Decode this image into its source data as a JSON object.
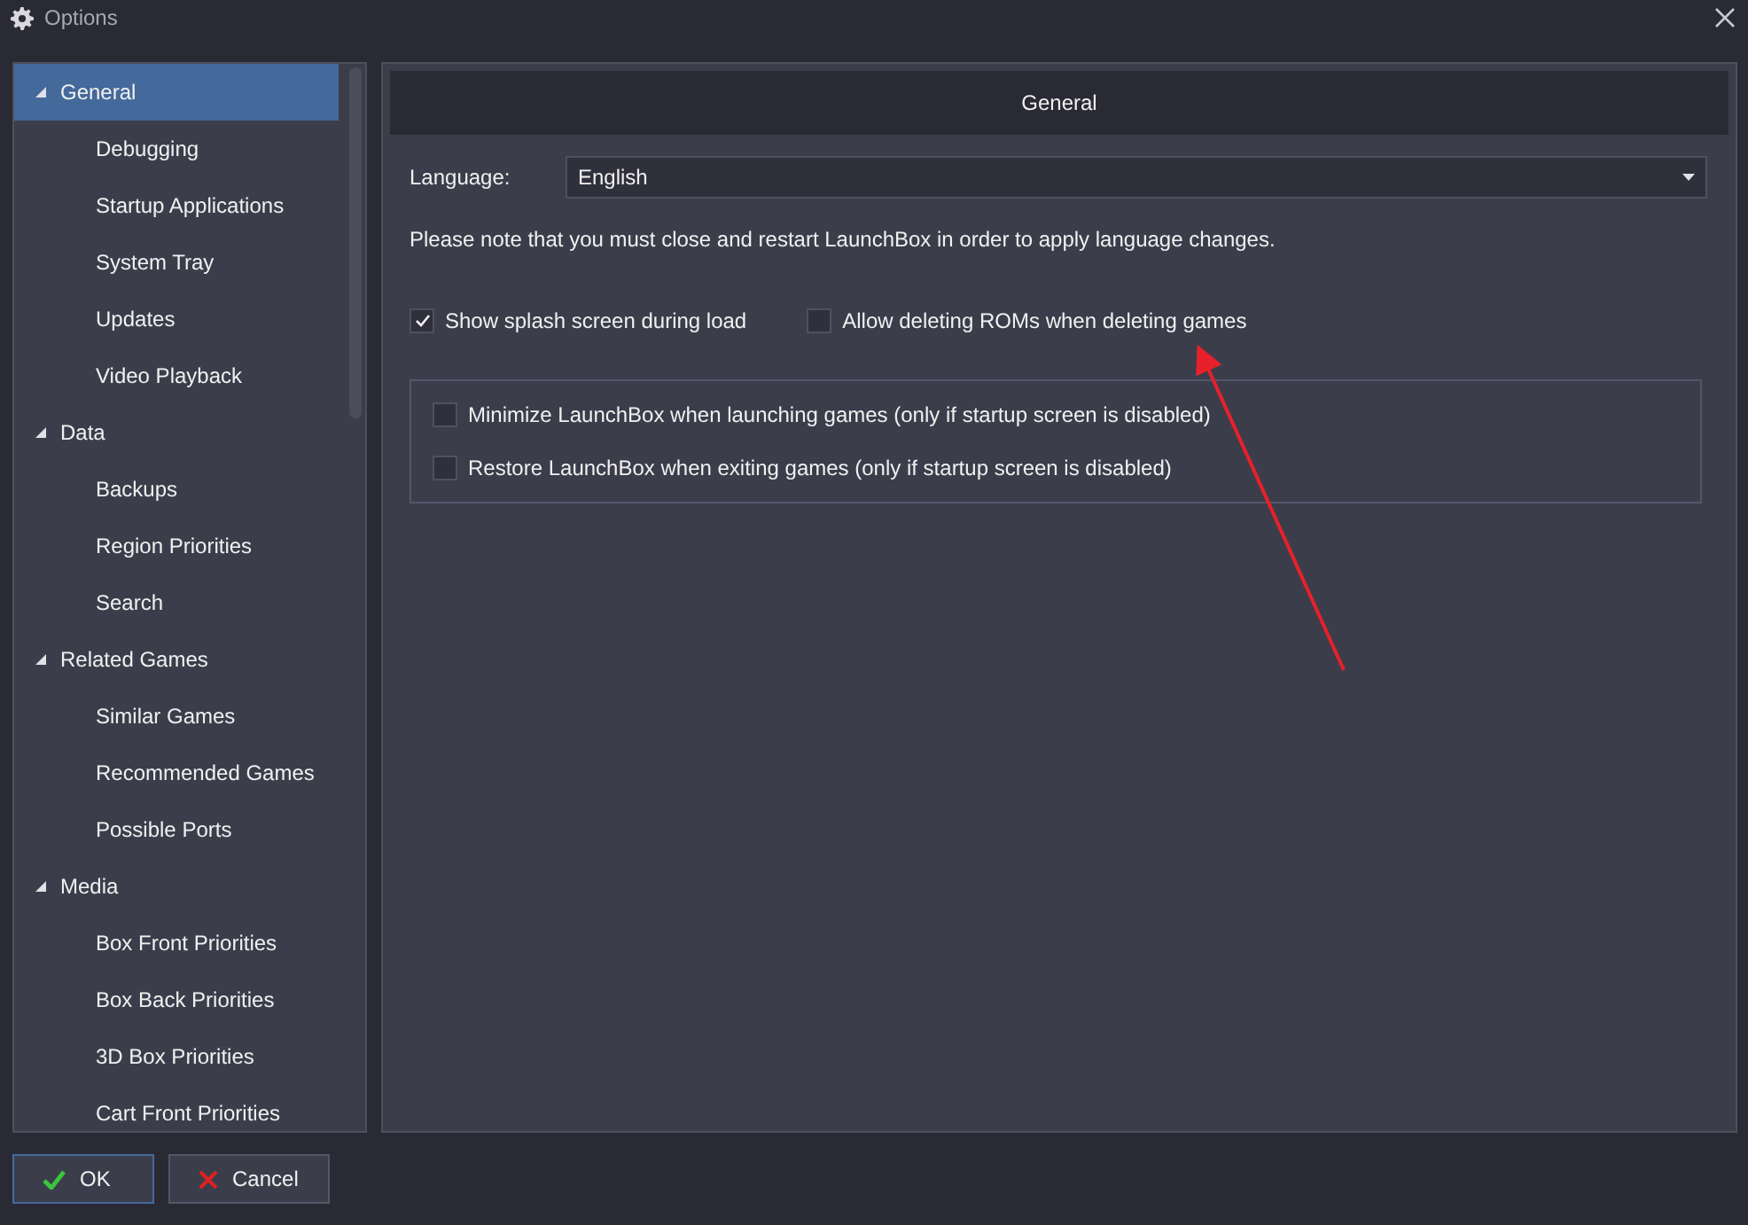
{
  "window": {
    "title": "Options"
  },
  "sidebar": {
    "items": [
      {
        "label": "General",
        "selected": true,
        "expanded": true,
        "children": [
          {
            "label": "Debugging",
            "selected": false
          },
          {
            "label": "Startup Applications",
            "selected": false
          },
          {
            "label": "System Tray",
            "selected": false
          },
          {
            "label": "Updates",
            "selected": false
          },
          {
            "label": "Video Playback",
            "selected": false
          }
        ]
      },
      {
        "label": "Data",
        "selected": false,
        "expanded": true,
        "children": [
          {
            "label": "Backups",
            "selected": false
          },
          {
            "label": "Region Priorities",
            "selected": false
          },
          {
            "label": "Search",
            "selected": false
          }
        ]
      },
      {
        "label": "Related Games",
        "selected": false,
        "expanded": true,
        "children": [
          {
            "label": "Similar Games",
            "selected": false
          },
          {
            "label": "Recommended Games",
            "selected": false
          },
          {
            "label": "Possible Ports",
            "selected": false
          }
        ]
      },
      {
        "label": "Media",
        "selected": false,
        "expanded": true,
        "children": [
          {
            "label": "Box Front Priorities",
            "selected": false
          },
          {
            "label": "Box Back Priorities",
            "selected": false
          },
          {
            "label": "3D Box Priorities",
            "selected": false
          },
          {
            "label": "Cart Front Priorities",
            "selected": false
          }
        ]
      }
    ]
  },
  "panel": {
    "header": "General",
    "language": {
      "label": "Language:",
      "value": "English"
    },
    "note": "Please note that you must close and restart LaunchBox in order to apply language changes.",
    "options": [
      {
        "label": "Show splash screen during load",
        "checked": true
      },
      {
        "label": "Allow deleting ROMs when deleting games",
        "checked": false
      }
    ],
    "group_options": [
      {
        "label": "Minimize LaunchBox when launching games (only if startup screen is disabled)",
        "checked": false
      },
      {
        "label": "Restore LaunchBox when exiting games (only if startup screen is disabled)",
        "checked": false
      }
    ]
  },
  "buttons": [
    {
      "label": "OK",
      "kind": "ok"
    },
    {
      "label": "Cancel",
      "kind": "cancel"
    }
  ]
}
